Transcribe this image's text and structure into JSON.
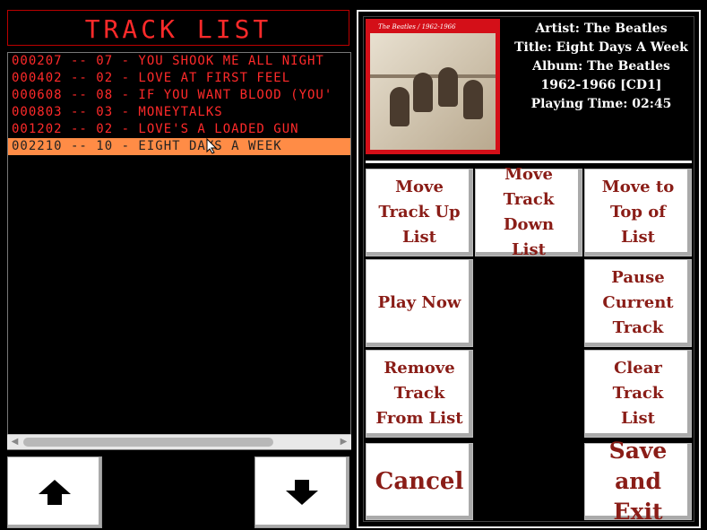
{
  "track_list": {
    "title": "TRACK LIST",
    "tracks": [
      "000207 -- 07 - YOU SHOOK ME ALL NIGHT",
      "000402 -- 02 - LOVE AT FIRST FEEL",
      "000608 -- 08 - IF YOU WANT BLOOD (YOU'",
      "000803 -- 03 - MONEYTALKS",
      "001202 -- 02 - LOVE'S A LOADED GUN",
      "002210 -- 10 - EIGHT DAYS A WEEK"
    ],
    "selected_index": 5
  },
  "now_playing": {
    "album_art_caption": "The Beatles / 1962-1966",
    "artist": "Artist: The Beatles",
    "title": "Title: Eight Days A Week",
    "album": "Album: The Beatles",
    "album_line2": "1962-1966 [CD1]",
    "playing_time": "Playing Time: 02:45"
  },
  "buttons": {
    "move_up": "Move Track Up List",
    "move_down": "Move Track Down List",
    "move_top": "Move to Top of List",
    "play_now": "Play Now",
    "pause": "Pause Current Track",
    "remove": "Remove Track From List",
    "clear": "Clear Track List",
    "cancel": "Cancel",
    "save_exit": "Save and Exit"
  },
  "icons": {
    "up": "arrow-up-icon",
    "down": "arrow-down-icon"
  },
  "colors": {
    "led_red": "#ff2a2a",
    "selected_row": "#ff8c46",
    "button_text": "#8a1d17"
  }
}
